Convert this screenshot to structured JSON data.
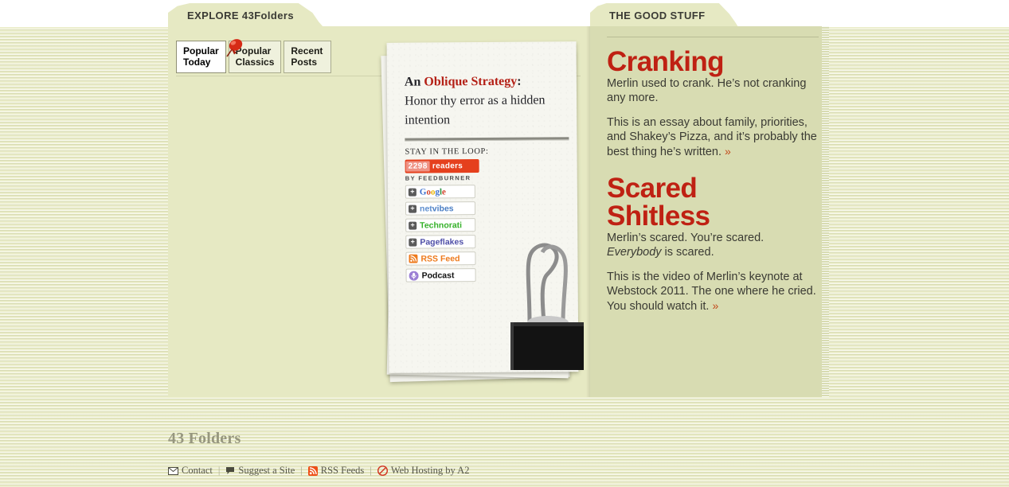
{
  "colors": {
    "page_bg": "#eceecd",
    "panel_main_bg": "#e6e9c3",
    "panel_right_bg": "#d8dcb2",
    "accent_red": "#bf2113",
    "oblique_red": "#b42016",
    "link_arrow": "#c2491b",
    "footer_title": "#97977f"
  },
  "tabs": {
    "explore": "EXPLORE 43Folders",
    "good_stuff": "THE GOOD STUFF"
  },
  "subtabs": [
    {
      "line1": "Popular",
      "line2": "Today",
      "active": true
    },
    {
      "line1": "Popular",
      "line2": "Classics",
      "active": false
    },
    {
      "line1": "Recent",
      "line2": "Posts",
      "active": false
    }
  ],
  "pushpin_icon": "pushpin-icon",
  "paper": {
    "oblique_prefix": "An ",
    "oblique_title": "Oblique Strategy",
    "oblique_colon": ":",
    "oblique_body": "Honor thy error as a hidden intention",
    "loop_label": "STAY IN THE LOOP:",
    "feedburner": {
      "count": "2298",
      "readers_label": "readers",
      "by_label": "BY FEEDBURNER"
    },
    "subscribe_buttons": [
      {
        "icon": "plus-icon",
        "label": "Google",
        "id": "google"
      },
      {
        "icon": "plus-icon",
        "label": "netvibes",
        "id": "netvibes"
      },
      {
        "icon": "plus-icon",
        "label": "Technorati",
        "id": "technorati"
      },
      {
        "icon": "plus-icon",
        "label": "Pageflakes",
        "id": "pageflakes"
      },
      {
        "icon": "rss-icon",
        "label": "RSS Feed",
        "id": "rssfeed"
      },
      {
        "icon": "podcast-icon",
        "label": "Podcast",
        "id": "podcast"
      }
    ],
    "binder_clip_icon": "binder-clip-icon"
  },
  "good_stuff": [
    {
      "title": "Cranking",
      "lead": "Merlin used to crank. He’s not cranking any more.",
      "body": "This is an essay about family, priorities, and Shakey’s Pizza, and it’s probably the best thing he’s written.",
      "more": "»"
    },
    {
      "title_line1": "Scared",
      "title_line2": "Shitless",
      "lead_a": "Merlin’s scared. You’re scared. ",
      "lead_em": "Everybody",
      "lead_b": " is scared.",
      "body": "This is the video of Merlin’s keynote at Webstock 2011. The one where he cried. You should watch it.",
      "more": "»"
    }
  ],
  "footer": {
    "site_title": "43 Folders",
    "links": [
      {
        "icon": "envelope-icon",
        "label": "Contact"
      },
      {
        "icon": "speech-bubble-icon",
        "label": "Suggest a Site"
      },
      {
        "icon": "rss-icon",
        "label": "RSS Feeds"
      },
      {
        "icon": "a2-hosting-icon",
        "label": "Web Hosting by A2"
      }
    ],
    "separator": "|"
  }
}
